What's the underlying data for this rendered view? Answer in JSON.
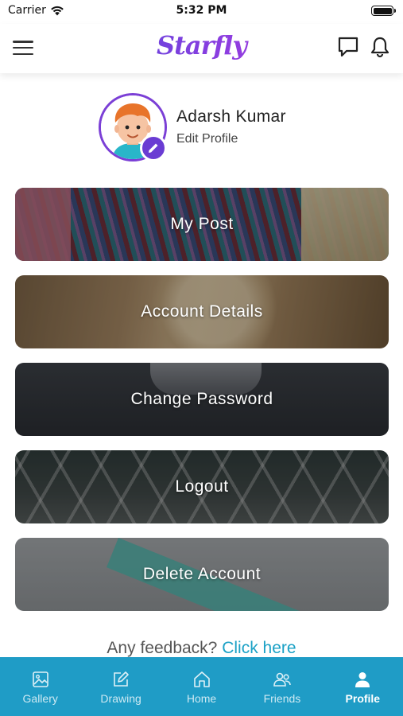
{
  "status_bar": {
    "carrier": "Carrier",
    "time": "5:32 PM"
  },
  "header": {
    "logo_text": "Starfly"
  },
  "profile": {
    "name": "Adarsh Kumar",
    "edit_label": "Edit Profile"
  },
  "menu": {
    "items": [
      {
        "label": "My Post"
      },
      {
        "label": "Account Details"
      },
      {
        "label": "Change Password"
      },
      {
        "label": "Logout"
      },
      {
        "label": "Delete Account"
      }
    ]
  },
  "feedback": {
    "prompt": "Any feedback?",
    "link": "Click here"
  },
  "tab_bar": {
    "tabs": [
      {
        "label": "Gallery",
        "icon": "gallery-icon"
      },
      {
        "label": "Drawing",
        "icon": "drawing-icon"
      },
      {
        "label": "Home",
        "icon": "home-icon"
      },
      {
        "label": "Friends",
        "icon": "friends-icon"
      },
      {
        "label": "Profile",
        "icon": "profile-icon",
        "active": true
      }
    ]
  },
  "colors": {
    "accent": "#1f9cc6",
    "avatar_ring": "#7b3fd6",
    "link": "#1ba1c6",
    "logo_gradient_start": "#3b4fd8",
    "logo_gradient_end": "#c23ad6"
  }
}
